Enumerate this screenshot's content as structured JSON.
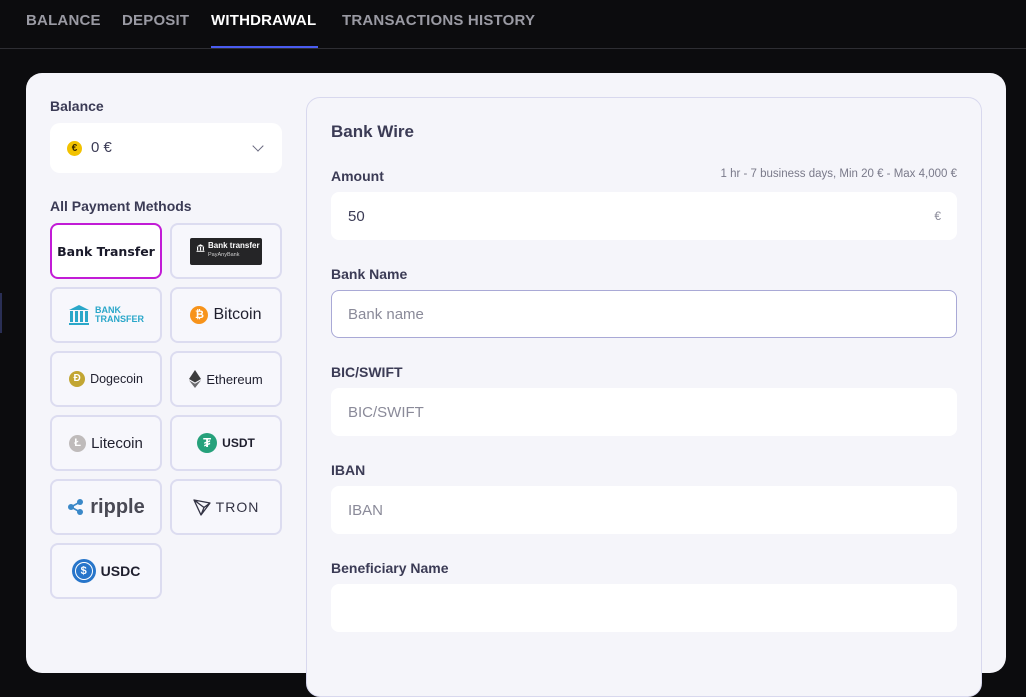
{
  "tabs": [
    {
      "label": "BALANCE"
    },
    {
      "label": "DEPOSIT"
    },
    {
      "label": "WITHDRAWAL"
    },
    {
      "label": "TRANSACTIONS HISTORY"
    }
  ],
  "active_tab": "WITHDRAWAL",
  "left": {
    "balance_label": "Balance",
    "balance_currency_symbol": "€",
    "balance_value": "0 €",
    "methods_label": "All Payment Methods",
    "methods": [
      {
        "label": "Bank Transfer"
      },
      {
        "label": "Bank transfer",
        "sublabel": "PayAnyBank"
      },
      {
        "label": "BANK",
        "sublabel": "TRANSFER"
      },
      {
        "label": "Bitcoin"
      },
      {
        "label": "Dogecoin"
      },
      {
        "label": "Ethereum"
      },
      {
        "label": "Litecoin"
      },
      {
        "label": "USDT"
      },
      {
        "label": "ripple"
      },
      {
        "label": "TRON"
      },
      {
        "label": "USDC"
      }
    ],
    "selected_method": "Bank Transfer"
  },
  "form": {
    "title": "Bank Wire",
    "amount_label": "Amount",
    "amount_hint": "1 hr - 7 business days, Min 20 € - Max 4,000 €",
    "amount_value": "50",
    "amount_currency": "€",
    "bank_name_label": "Bank Name",
    "bank_name_placeholder": "Bank name",
    "bic_label": "BIC/SWIFT",
    "bic_placeholder": "BIC/SWIFT",
    "iban_label": "IBAN",
    "iban_placeholder": "IBAN",
    "beneficiary_label": "Beneficiary Name",
    "beneficiary_placeholder": ""
  },
  "colors": {
    "page_bg": "#0c0c0e",
    "tab_underline": "#4a5cf0",
    "selected_border": "#c21bd6",
    "bitcoin": "#f7931a",
    "dogecoin": "#c2a633",
    "tether": "#26a17b",
    "usdc": "#2775ca",
    "ripple": "#3a88c8",
    "bank_teal": "#2aa7c9"
  }
}
